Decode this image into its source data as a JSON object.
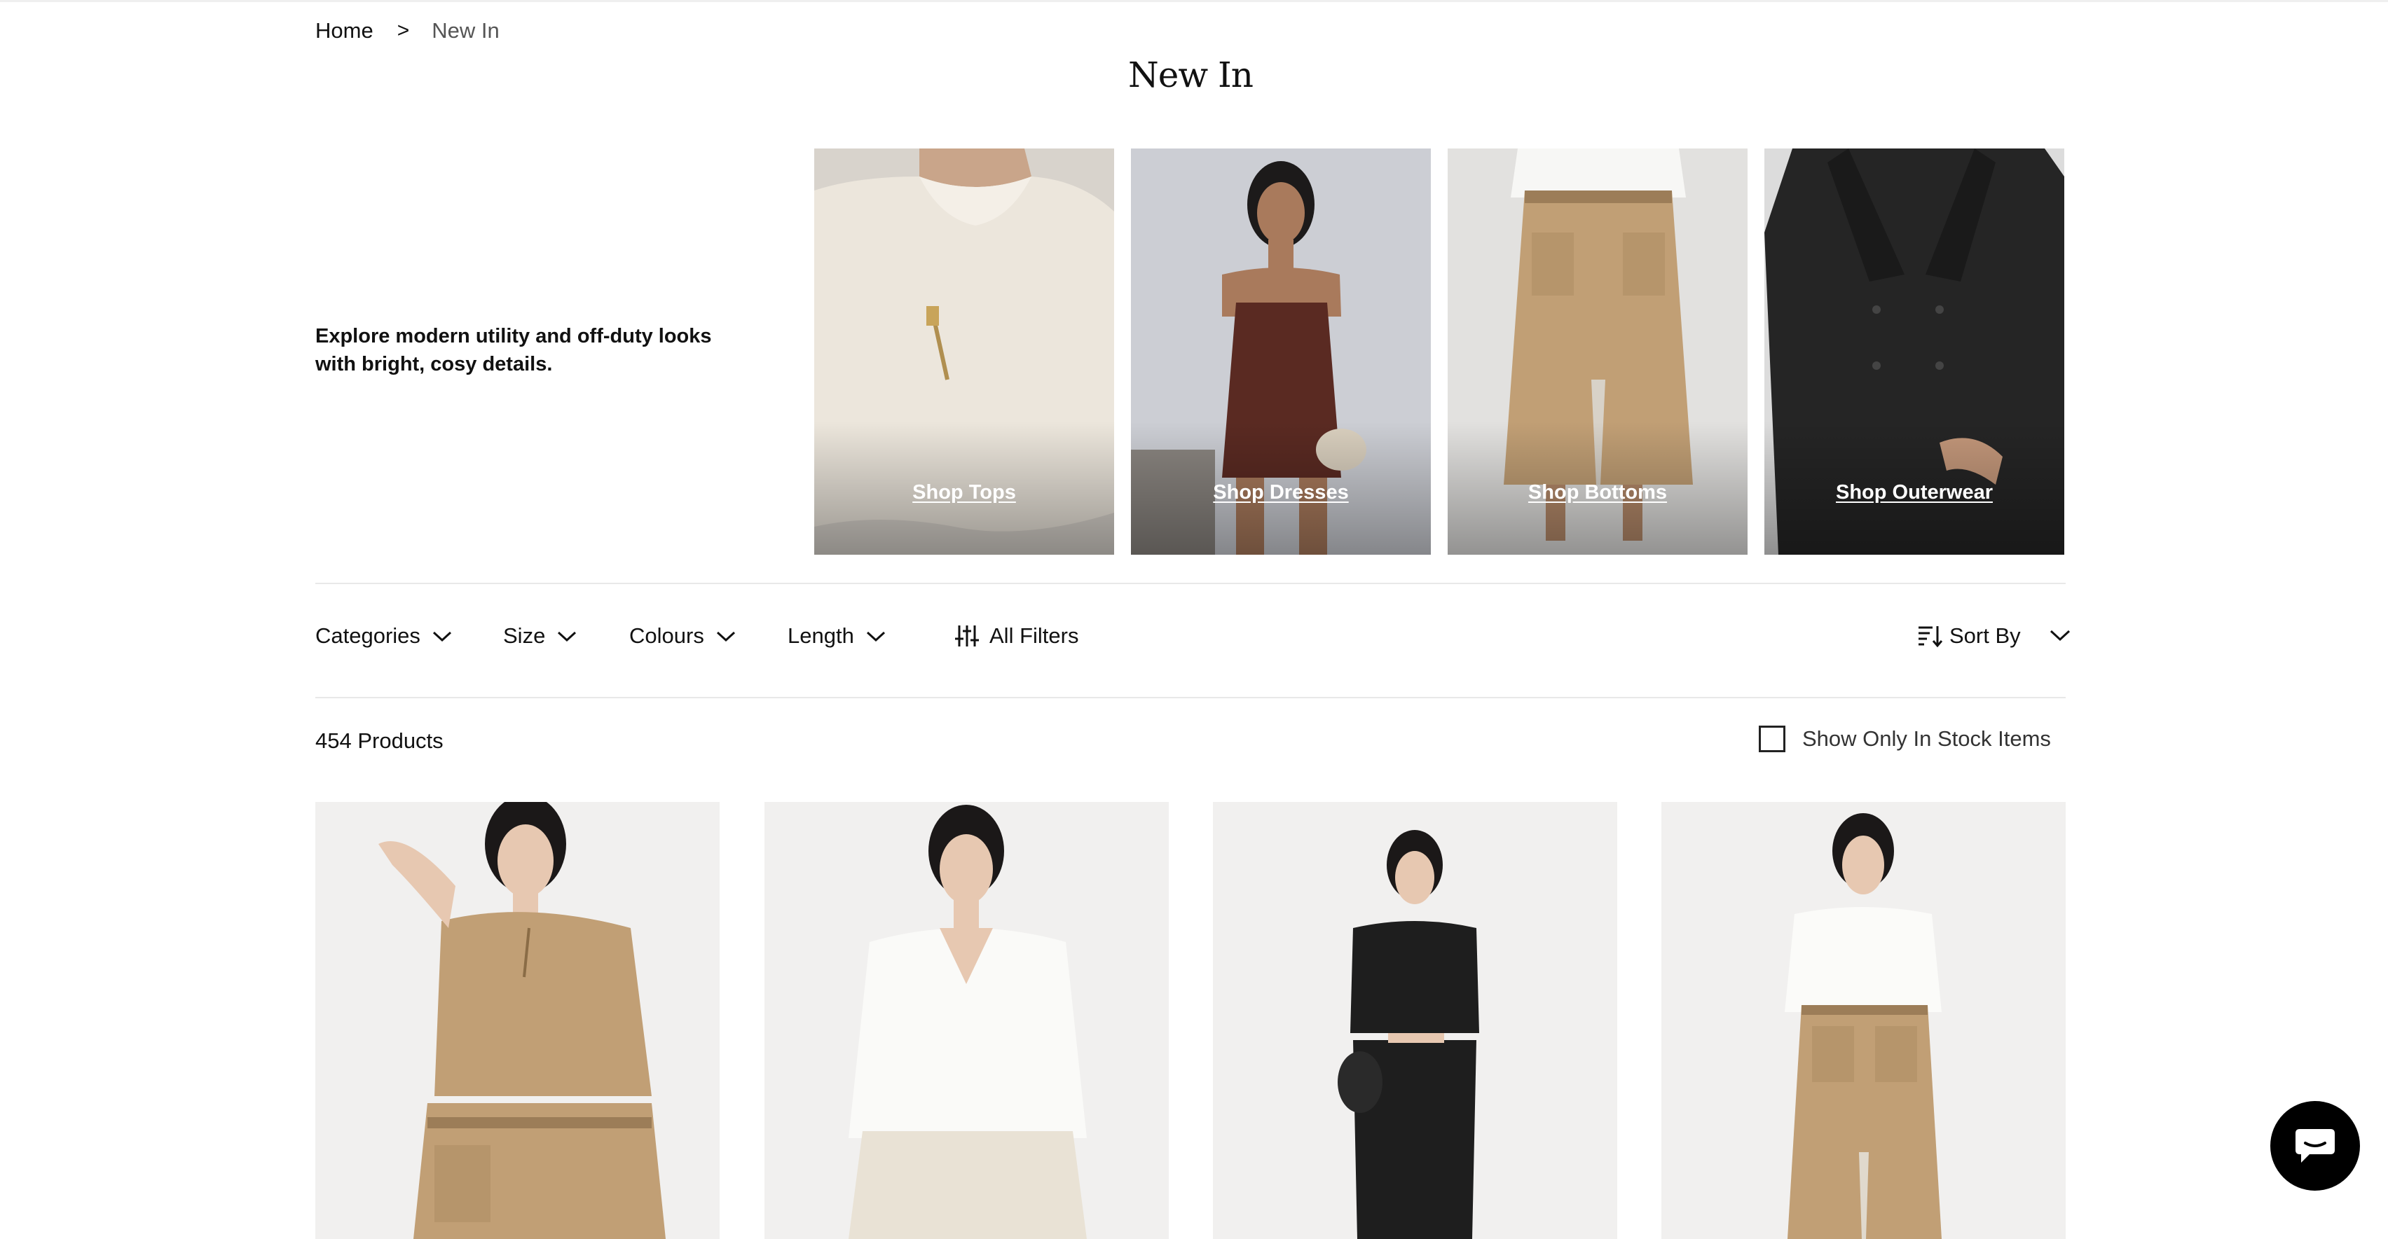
{
  "breadcrumb": {
    "home": "Home",
    "separator": ">",
    "current": "New In"
  },
  "page": {
    "title": "New In",
    "intro": "Explore modern utility and off-duty looks with bright, cosy details."
  },
  "tiles": [
    {
      "label": "Shop Tops"
    },
    {
      "label": "Shop Dresses"
    },
    {
      "label": "Shop Bottoms"
    },
    {
      "label": "Shop Outerwear"
    }
  ],
  "filters": {
    "categories": "Categories",
    "size": "Size",
    "colours": "Colours",
    "length": "Length",
    "all_filters": "All Filters",
    "sort_by": "Sort By"
  },
  "results": {
    "count": "454 Products",
    "stock_toggle": "Show Only In Stock Items"
  },
  "icons": {
    "filter": "sliders-icon",
    "sort": "sort-icon",
    "chevron": "chevron-down-icon",
    "chat": "chat-icon"
  },
  "colors": {
    "camel": "#c19f75",
    "ivory": "#efe8de",
    "burgundy": "#5a2a22",
    "black": "#1e1e1e",
    "background": "#f1f0ef"
  }
}
